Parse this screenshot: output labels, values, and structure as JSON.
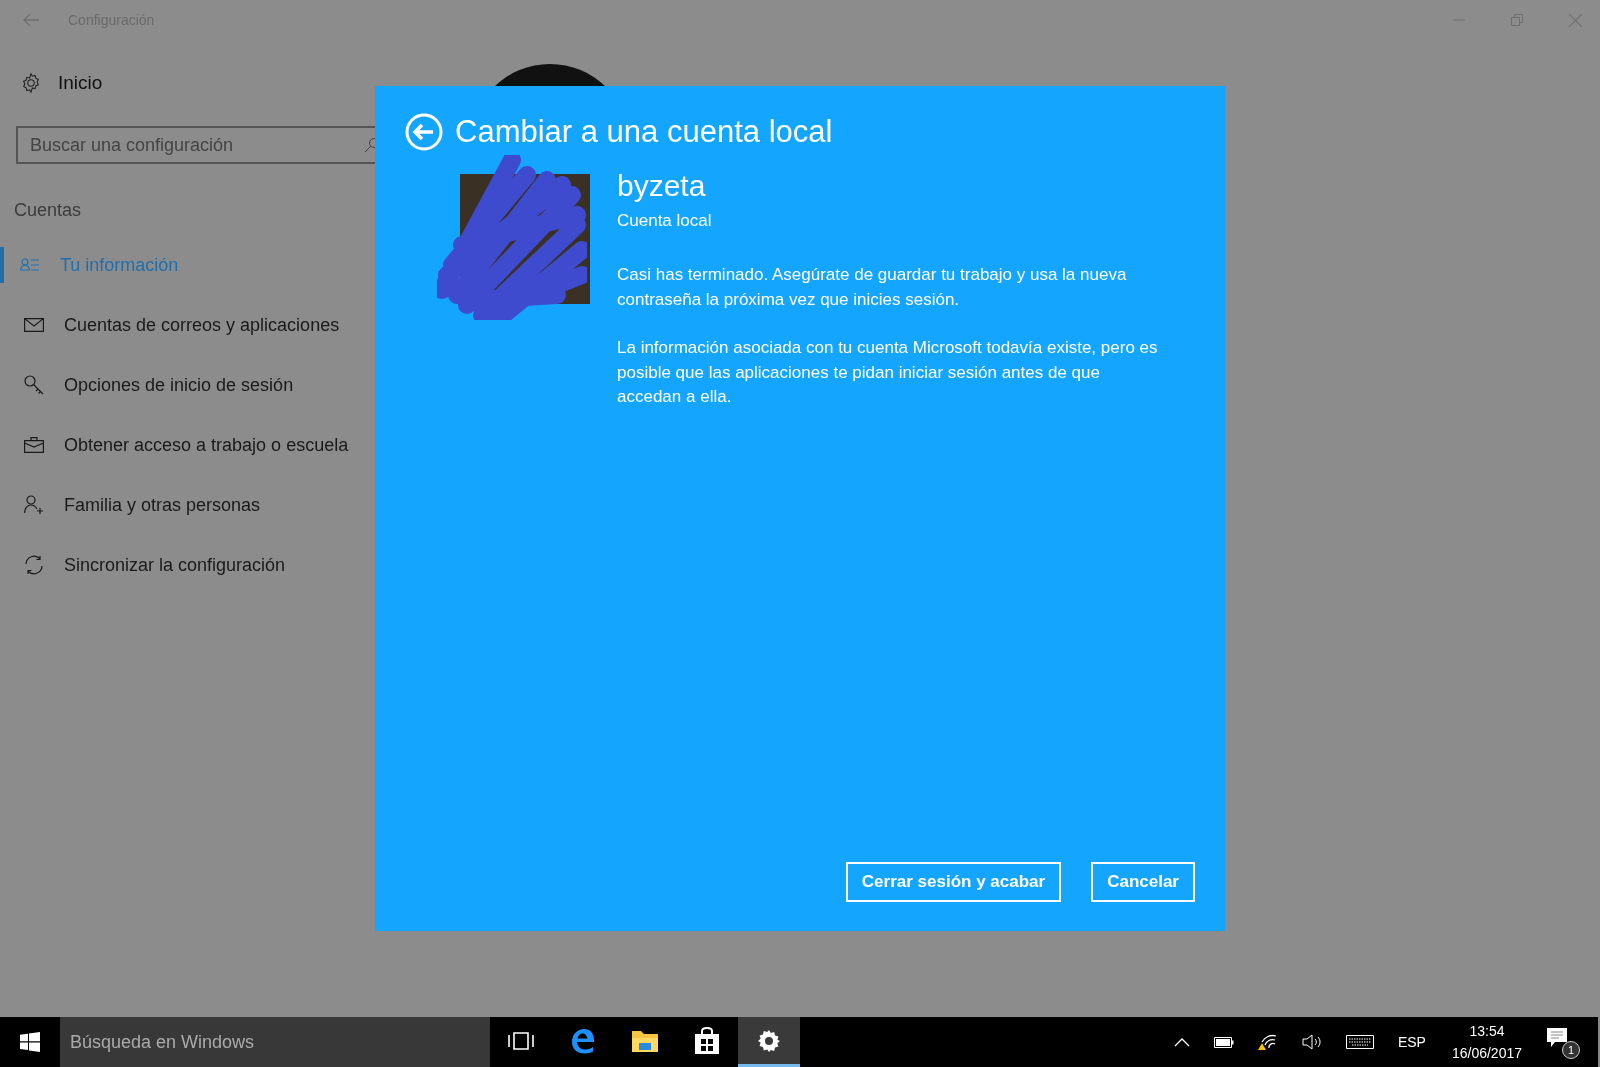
{
  "window": {
    "title": "Configuración"
  },
  "sidebar": {
    "home": "Inicio",
    "search": {
      "placeholder": "Buscar una configuración"
    },
    "section": "Cuentas",
    "items": [
      {
        "label": "Tu información",
        "kind": "info",
        "selected": true
      },
      {
        "label": "Cuentas de correos y aplicaciones",
        "kind": "mail",
        "selected": false
      },
      {
        "label": "Opciones de inicio de sesión",
        "kind": "key",
        "selected": false
      },
      {
        "label": "Obtener acceso a trabajo o escuela",
        "kind": "work",
        "selected": false
      },
      {
        "label": "Familia y otras personas",
        "kind": "family",
        "selected": false
      },
      {
        "label": "Sincronizar la configuración",
        "kind": "sync",
        "selected": false
      }
    ]
  },
  "dialog": {
    "title": "Cambiar a una cuenta local",
    "account_name": "byzeta",
    "account_type": "Cuenta local",
    "paragraphs": [
      "Casi has terminado. Asegúrate de guardar tu trabajo y usa la nueva contraseña la próxima vez que inicies sesión.",
      "La información asociada con tu cuenta Microsoft todavía existe, pero es posible que las aplicaciones te pidan iniciar sesión antes de que accedan a ella."
    ],
    "buttons": [
      "Cerrar sesión y acabar",
      "Cancelar"
    ]
  },
  "taskbar": {
    "search": {
      "placeholder": "Búsqueda en Windows"
    },
    "apps": [
      {
        "kind": "taskview",
        "selected": false
      },
      {
        "kind": "edge",
        "selected": false
      },
      {
        "kind": "explorer",
        "selected": false
      },
      {
        "kind": "store",
        "selected": false
      },
      {
        "kind": "settings",
        "selected": true
      }
    ],
    "language": "ESP",
    "time": "13:54",
    "date": "16/06/2017",
    "notifications": "1"
  }
}
